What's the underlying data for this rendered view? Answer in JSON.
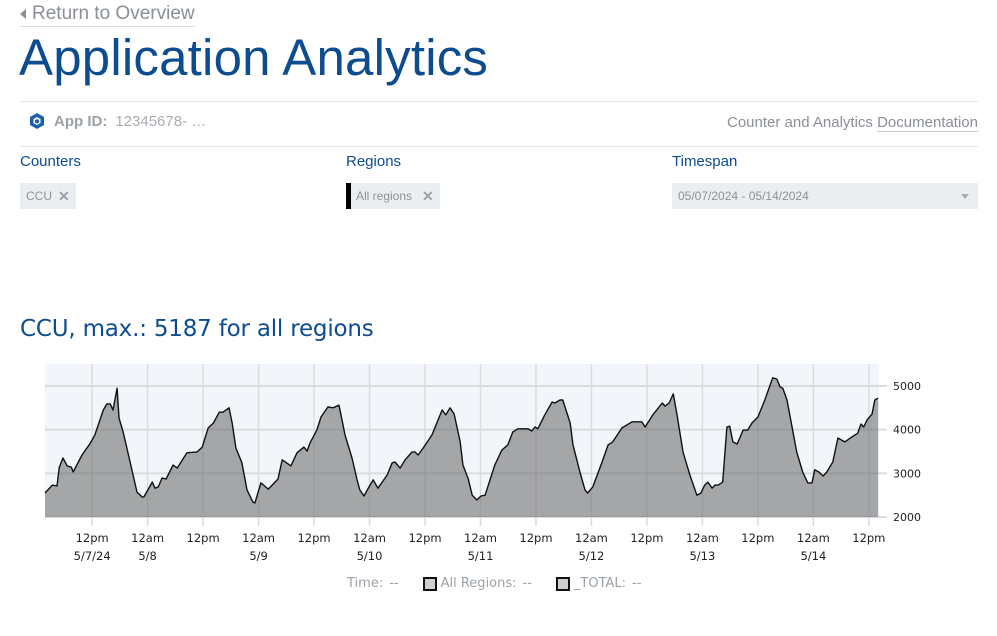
{
  "nav": {
    "back_label": "Return to Overview"
  },
  "header": {
    "title": "Application Analytics"
  },
  "app_info": {
    "app_id_label": "App ID:",
    "app_id_value": "12345678-  …",
    "icon": "unity-logo-icon",
    "doc_prefix": "Counter and Analytics ",
    "doc_link": "Documentation"
  },
  "filters": {
    "counters": {
      "label": "Counters",
      "chips": [
        {
          "label": "CCU"
        }
      ]
    },
    "regions": {
      "label": "Regions",
      "chips": [
        {
          "label": "All regions"
        }
      ]
    },
    "timespan": {
      "label": "Timespan",
      "value": "05/07/2024 - 05/14/2024"
    }
  },
  "colors": {
    "accent": "#0d4c8f",
    "plot_bg": "#f2f6fa",
    "area_fill": "#a0a1a3",
    "line": "#111111",
    "grid": "#d9dcdf"
  },
  "chart_data": {
    "type": "area",
    "title": "CCU, max.: 5187 for all regions",
    "xlabel": "",
    "ylabel": "",
    "x_unit": "hours since 5/7/24 00:00",
    "xlim": [
      1.8,
      182.2
    ],
    "ylim": [
      2000,
      5300
    ],
    "yticks": [
      2000,
      3000,
      4000,
      5000
    ],
    "ytick_labels": [
      "2000",
      "3000",
      "4000",
      "5000"
    ],
    "xticks": [
      12,
      24,
      36,
      48,
      60,
      72,
      84,
      96,
      108,
      120,
      132,
      144,
      156,
      168,
      180
    ],
    "xtick_labels": [
      [
        "12pm",
        "5/7/24"
      ],
      [
        "12am",
        "5/8"
      ],
      [
        "12pm",
        ""
      ],
      [
        "12am",
        "5/9"
      ],
      [
        "12pm",
        ""
      ],
      [
        "12am",
        "5/10"
      ],
      [
        "12pm",
        ""
      ],
      [
        "12am",
        "5/11"
      ],
      [
        "12pm",
        ""
      ],
      [
        "12am",
        "5/12"
      ],
      [
        "12pm",
        ""
      ],
      [
        "12am",
        "5/13"
      ],
      [
        "12pm",
        ""
      ],
      [
        "12am",
        "5/14"
      ],
      [
        "12pm",
        ""
      ]
    ],
    "grid": true,
    "legend_position": "bottom",
    "legend": {
      "time_label": "Time:",
      "time_value": "--",
      "entries": [
        {
          "name": "All Regions:",
          "value": "--"
        },
        {
          "name": "_TOTAL:",
          "value": "--"
        }
      ]
    },
    "series": [
      {
        "name": "All Regions",
        "points": [
          [
            1.8,
            2550
          ],
          [
            3.4,
            2730
          ],
          [
            4.4,
            2710
          ],
          [
            4.9,
            3140
          ],
          [
            5.7,
            3350
          ],
          [
            6.6,
            3170
          ],
          [
            7.5,
            3140
          ],
          [
            7.9,
            3030
          ],
          [
            9.8,
            3420
          ],
          [
            11.6,
            3690
          ],
          [
            12.6,
            3880
          ],
          [
            14.4,
            4450
          ],
          [
            15.2,
            4590
          ],
          [
            15.9,
            4590
          ],
          [
            16.5,
            4450
          ],
          [
            17.4,
            4950
          ],
          [
            17.8,
            4270
          ],
          [
            18.7,
            3950
          ],
          [
            20.2,
            3260
          ],
          [
            21.7,
            2570
          ],
          [
            22.8,
            2460
          ],
          [
            23.2,
            2460
          ],
          [
            25.0,
            2800
          ],
          [
            25.6,
            2660
          ],
          [
            26.3,
            2690
          ],
          [
            27.1,
            2890
          ],
          [
            28.0,
            2870
          ],
          [
            29.5,
            3190
          ],
          [
            30.4,
            3120
          ],
          [
            32.5,
            3470
          ],
          [
            34.7,
            3490
          ],
          [
            35.8,
            3600
          ],
          [
            37.1,
            4040
          ],
          [
            38.2,
            4150
          ],
          [
            39.5,
            4400
          ],
          [
            40.3,
            4400
          ],
          [
            41.6,
            4500
          ],
          [
            42.3,
            4150
          ],
          [
            43.1,
            3580
          ],
          [
            44.4,
            3240
          ],
          [
            45.5,
            2620
          ],
          [
            46.8,
            2340
          ],
          [
            47.2,
            2320
          ],
          [
            48.5,
            2780
          ],
          [
            50.1,
            2640
          ],
          [
            52.2,
            2870
          ],
          [
            53.1,
            3310
          ],
          [
            55.0,
            3170
          ],
          [
            56.3,
            3470
          ],
          [
            57.8,
            3600
          ],
          [
            58.5,
            3510
          ],
          [
            59.1,
            3690
          ],
          [
            60.6,
            3990
          ],
          [
            61.5,
            4290
          ],
          [
            63.0,
            4520
          ],
          [
            64.1,
            4500
          ],
          [
            65.4,
            4560
          ],
          [
            66.7,
            3880
          ],
          [
            68.2,
            3350
          ],
          [
            69.3,
            2850
          ],
          [
            69.9,
            2620
          ],
          [
            70.8,
            2480
          ],
          [
            72.1,
            2730
          ],
          [
            72.8,
            2850
          ],
          [
            73.8,
            2660
          ],
          [
            75.8,
            2960
          ],
          [
            76.9,
            3240
          ],
          [
            77.5,
            3260
          ],
          [
            78.6,
            3120
          ],
          [
            79.7,
            3310
          ],
          [
            81.2,
            3490
          ],
          [
            81.8,
            3490
          ],
          [
            82.5,
            3420
          ],
          [
            83.6,
            3580
          ],
          [
            85.5,
            3880
          ],
          [
            87.7,
            4450
          ],
          [
            88.5,
            4340
          ],
          [
            89.4,
            4500
          ],
          [
            90.3,
            4360
          ],
          [
            91.6,
            3720
          ],
          [
            92.2,
            3190
          ],
          [
            93.3,
            2890
          ],
          [
            94.2,
            2500
          ],
          [
            95.2,
            2390
          ],
          [
            96.1,
            2480
          ],
          [
            97.0,
            2500
          ],
          [
            99.1,
            3190
          ],
          [
            100.6,
            3530
          ],
          [
            101.9,
            3650
          ],
          [
            103.0,
            3950
          ],
          [
            104.1,
            4020
          ],
          [
            106.3,
            4020
          ],
          [
            107.1,
            3970
          ],
          [
            107.8,
            4060
          ],
          [
            108.4,
            4020
          ],
          [
            109.9,
            4340
          ],
          [
            111.5,
            4630
          ],
          [
            112.1,
            4610
          ],
          [
            113.2,
            4680
          ],
          [
            113.8,
            4680
          ],
          [
            115.4,
            4150
          ],
          [
            116.0,
            3650
          ],
          [
            117.5,
            3030
          ],
          [
            118.6,
            2620
          ],
          [
            119.2,
            2550
          ],
          [
            120.3,
            2690
          ],
          [
            122.3,
            3260
          ],
          [
            123.6,
            3650
          ],
          [
            124.6,
            3720
          ],
          [
            126.6,
            4040
          ],
          [
            128.8,
            4180
          ],
          [
            130.9,
            4180
          ],
          [
            131.6,
            4060
          ],
          [
            133.3,
            4340
          ],
          [
            135.3,
            4610
          ],
          [
            135.9,
            4540
          ],
          [
            136.8,
            4610
          ],
          [
            137.7,
            4820
          ],
          [
            138.5,
            4340
          ],
          [
            139.8,
            3490
          ],
          [
            141.3,
            2960
          ],
          [
            142.8,
            2500
          ],
          [
            143.7,
            2550
          ],
          [
            144.5,
            2730
          ],
          [
            145.2,
            2800
          ],
          [
            146.1,
            2660
          ],
          [
            146.7,
            2730
          ],
          [
            147.4,
            2730
          ],
          [
            148.4,
            2800
          ],
          [
            149.3,
            4060
          ],
          [
            149.9,
            4080
          ],
          [
            150.6,
            3720
          ],
          [
            151.5,
            3670
          ],
          [
            152.8,
            3990
          ],
          [
            153.8,
            3990
          ],
          [
            154.7,
            4150
          ],
          [
            156.0,
            4290
          ],
          [
            157.5,
            4680
          ],
          [
            159.2,
            5187
          ],
          [
            160.1,
            5160
          ],
          [
            160.8,
            4980
          ],
          [
            161.4,
            4950
          ],
          [
            162.3,
            4680
          ],
          [
            164.4,
            3490
          ],
          [
            165.7,
            3030
          ],
          [
            166.8,
            2780
          ],
          [
            167.7,
            2780
          ],
          [
            168.3,
            3080
          ],
          [
            169.2,
            3030
          ],
          [
            170.1,
            2940
          ],
          [
            170.9,
            3030
          ],
          [
            172.2,
            3260
          ],
          [
            173.3,
            3810
          ],
          [
            174.8,
            3720
          ],
          [
            176.3,
            3830
          ],
          [
            177.6,
            3920
          ],
          [
            178.3,
            4130
          ],
          [
            178.9,
            4060
          ],
          [
            179.6,
            4220
          ],
          [
            180.7,
            4360
          ],
          [
            181.3,
            4680
          ],
          [
            182.0,
            4720
          ]
        ]
      }
    ]
  }
}
